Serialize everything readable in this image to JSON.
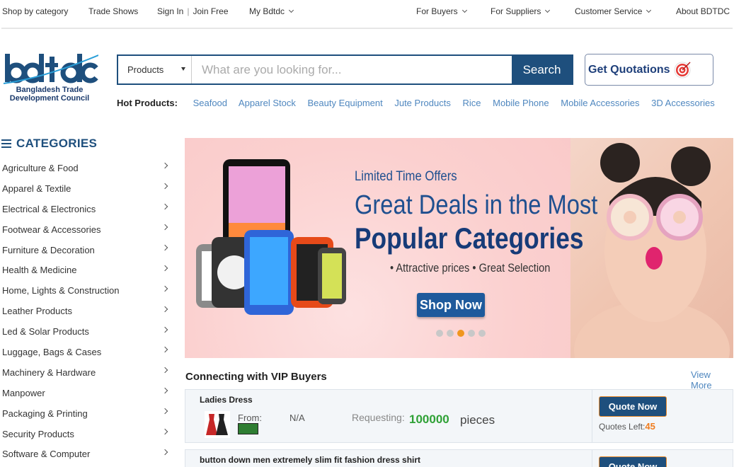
{
  "topbar": {
    "shop_by_category": "Shop by category",
    "trade_shows": "Trade Shows",
    "sign_in": "Sign In",
    "separator": "|",
    "join_free": "Join Free",
    "my_account": "My Bdtdc",
    "for_buyers": "For Buyers",
    "for_suppliers": "For Suppliers",
    "customer_service": "Customer Service",
    "about": "About BDTDC"
  },
  "logo": {
    "brand": "bdtdc",
    "tagline_line1": "Bangladesh Trade",
    "tagline_line2": "Development Council",
    "brand_color": "#1e4f7d"
  },
  "search": {
    "category": "Products",
    "placeholder": "What are you looking for...",
    "button": "Search"
  },
  "quotation_button": "Get Quotations",
  "hot_products": {
    "title": "Hot Products:",
    "items": [
      "Seafood",
      "Apparel Stock",
      "Beauty Equipment",
      "Jute Products",
      "Rice",
      "Mobile Phone",
      "Mobile Accessories",
      "3D Accessories"
    ]
  },
  "categories": {
    "title": "CATEGORIES",
    "items": [
      "Agriculture & Food",
      "Apparel & Textile",
      "Electrical & Electronics",
      "Footwear & Accessories",
      "Furniture & Decoration",
      "Health & Medicine",
      "Home, Lights & Construction",
      "Leather Products",
      "Led & Solar Products",
      "Luggage, Bags & Cases",
      "Machinery & Hardware",
      "Manpower",
      "Packaging & Printing",
      "Security Products",
      "Software & Computer"
    ]
  },
  "banner": {
    "kicker": "Limited Time Offers",
    "headline": "Great Deals in the Most",
    "headline_big": "Popular Categories",
    "bullets": "• Attractive prices   • Great Selection",
    "cta": "Shop Now",
    "slide_count": 5,
    "active_slide": 3
  },
  "vip": {
    "title": "Connecting with VIP Buyers",
    "view_more": "View More",
    "rows": [
      {
        "title": "Ladies Dress",
        "from_label": "From:",
        "from_value": "N/A",
        "requesting_label": "Requesting:",
        "quantity": "100000",
        "unit": "pieces",
        "button": "Quote Now",
        "quotes_left_label": "Quotes Left:",
        "quotes_left": "45"
      },
      {
        "title": "button down men extremely slim fit fashion dress shirt",
        "button": "Quote Now"
      }
    ]
  },
  "colors": {
    "primary": "#1e4f7d",
    "link": "#4f87bf",
    "accent_orange": "#f0961e",
    "quantity_green": "#2fa136"
  }
}
